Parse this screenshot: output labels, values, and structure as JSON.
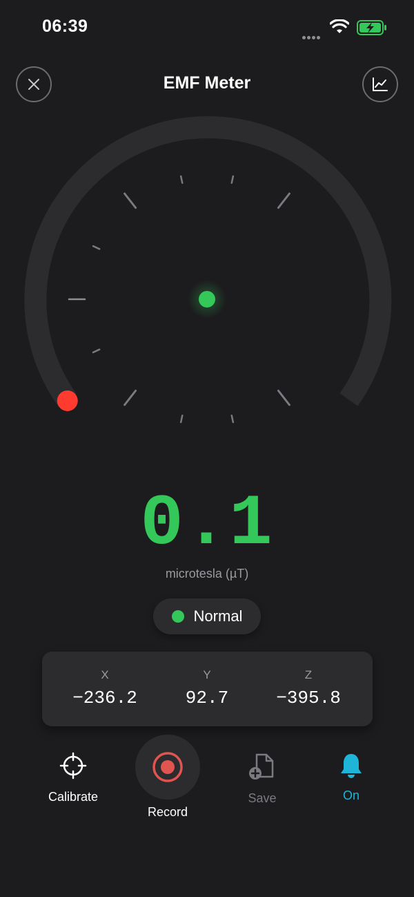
{
  "status_bar": {
    "time": "06:39"
  },
  "header": {
    "title": "EMF Meter"
  },
  "gauge": {
    "level_fraction": 0.0
  },
  "reading": {
    "value": "0.1",
    "unit": "microtesla (µT)"
  },
  "status": {
    "label": "Normal"
  },
  "axes": [
    {
      "label": "X",
      "value": "−236.2"
    },
    {
      "label": "Y",
      "value": "92.7"
    },
    {
      "label": "Z",
      "value": "−395.8"
    }
  ],
  "toolbar": {
    "calibrate_label": "Calibrate",
    "record_label": "Record",
    "save_label": "Save",
    "alert_label": "On"
  },
  "colors": {
    "background": "#1c1c1e",
    "reading_green": "#34c759",
    "needle_red": "#ff3b30",
    "alert_cyan": "#1fb5d8",
    "record_red": "#e05550"
  },
  "icons": {
    "close": "close-icon",
    "chart": "chart-icon",
    "calibrate": "crosshair-icon",
    "record": "record-icon",
    "save": "add-file-icon",
    "alert": "bell-icon"
  }
}
